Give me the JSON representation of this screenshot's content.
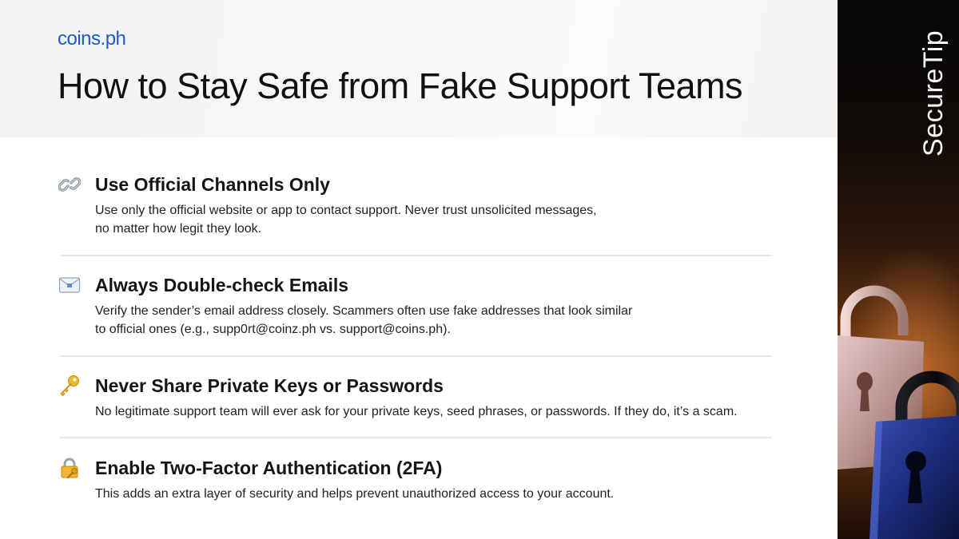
{
  "header": {
    "logo_text": "coins.ph",
    "title": "How to Stay Safe from Fake Support Teams"
  },
  "side_panel": {
    "label": "SecureTip"
  },
  "tips": [
    {
      "icon": "link-icon",
      "title": "Use Official Channels Only",
      "desc_line1": "Use only the official website or app to contact support. Never trust unsolicited messages,",
      "desc_line2": "no matter how legit they look."
    },
    {
      "icon": "envelope-icon",
      "title": "Always Double-check Emails",
      "desc_line1": "Verify the sender’s email address closely. Scammers often use fake addresses that look similar",
      "desc_line2": "to official ones (e.g., supp0rt@coinz.ph vs. support@coins.ph)."
    },
    {
      "icon": "key-icon",
      "title": "Never Share Private Keys or Passwords",
      "desc_line1": "No legitimate support team will ever ask for your private keys, seed phrases, or passwords. If they do, it’s a scam."
    },
    {
      "icon": "locked-with-key-icon",
      "title": "Enable Two-Factor Authentication (2FA)",
      "desc_line1": "This adds an extra layer of security and helps prevent unauthorized access to your account."
    }
  ],
  "colors": {
    "brand": "#1a5cd6",
    "title_text": "#111111",
    "divider": "#e6e6e6",
    "panel_dark": "#0e0a08",
    "panel_orange": "#7a3d12"
  }
}
